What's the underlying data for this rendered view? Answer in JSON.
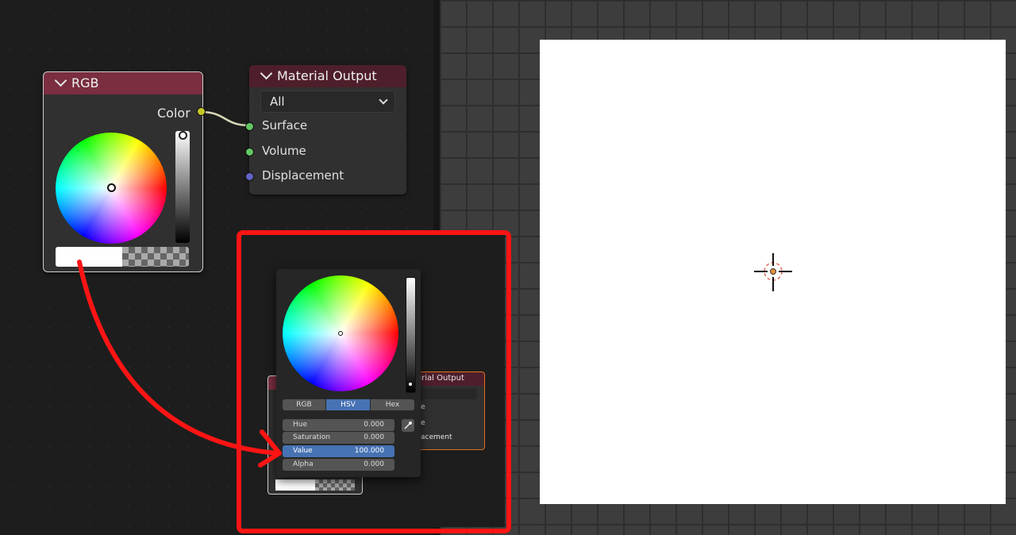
{
  "rgb_node": {
    "title": "RGB",
    "output_label": "Color"
  },
  "material_output_node": {
    "title": "Material Output",
    "target_value": "All",
    "inputs": [
      "Surface",
      "Volume",
      "Displacement"
    ]
  },
  "zoomed_inset": {
    "material_output_title_partial": "erial Output",
    "inputs_partial": [
      "e",
      "e",
      "acement"
    ]
  },
  "color_picker": {
    "modes": [
      "RGB",
      "HSV",
      "Hex"
    ],
    "active_mode": "HSV",
    "fields": [
      {
        "label": "Hue",
        "value": "0.000"
      },
      {
        "label": "Saturation",
        "value": "0.000"
      },
      {
        "label": "Value",
        "value": "100.000",
        "active": true
      },
      {
        "label": "Alpha",
        "value": "0.000"
      }
    ]
  },
  "colors": {
    "node_header_rgb": "#7a2e40",
    "node_header_output": "#4e1f2a",
    "annotation_red": "#ff1414",
    "highlight_blue": "#4772b3",
    "socket_yellow": "#c7c729",
    "socket_green": "#63c763",
    "socket_purple": "#6363c7"
  },
  "icons": [
    "chevron-down-icon",
    "eyedropper-icon",
    "cursor-crosshair-icon"
  ]
}
